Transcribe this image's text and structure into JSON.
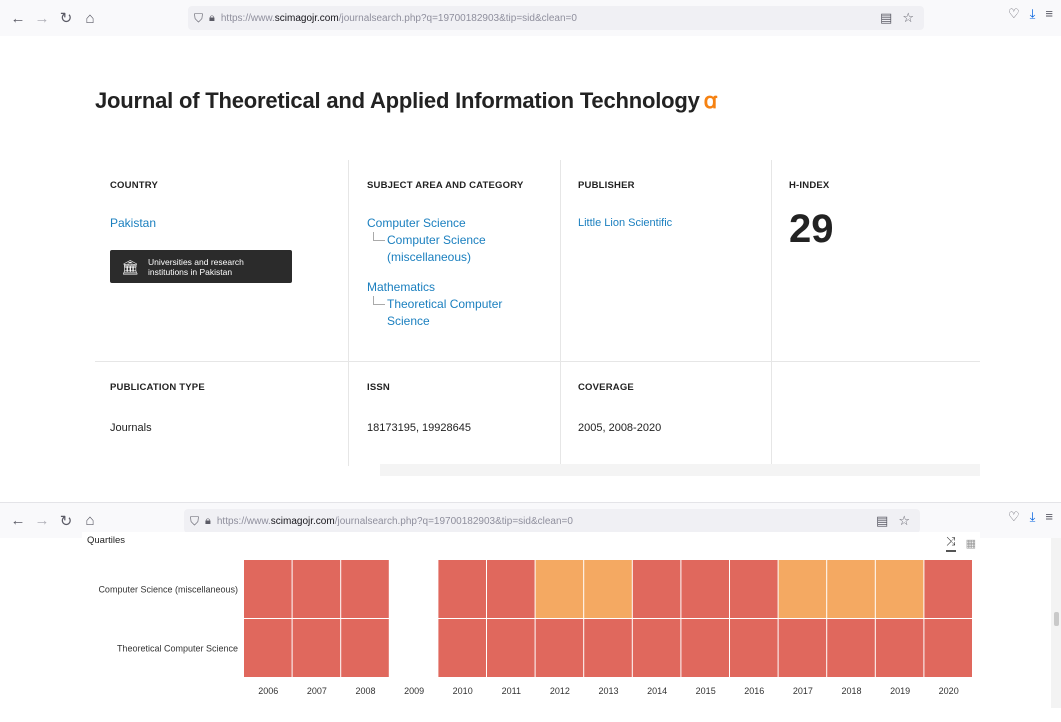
{
  "browser": {
    "url_prefix": "https://www.",
    "url_host": "scimagojr.com",
    "url_path": "/journalsearch.php?q=19700182903&tip=sid&clean=0"
  },
  "journal": {
    "title": "Journal of Theoretical and Applied Information Technology",
    "country_head": "COUNTRY",
    "country": "Pakistan",
    "uni_button": "Universities and research institutions in Pakistan",
    "subject_head": "SUBJECT AREA AND CATEGORY",
    "subjects": [
      {
        "area": "Computer Science",
        "category": "Computer Science (miscellaneous)"
      },
      {
        "area": "Mathematics",
        "category": "Theoretical Computer Science"
      }
    ],
    "publisher_head": "PUBLISHER",
    "publisher": "Little Lion Scientific",
    "hindex_head": "H-INDEX",
    "hindex": "29",
    "pubtype_head": "PUBLICATION TYPE",
    "pubtype": "Journals",
    "issn_head": "ISSN",
    "issn": "18173195, 19928645",
    "coverage_head": "COVERAGE",
    "coverage": "2005, 2008-2020"
  },
  "quartiles": {
    "title": "Quartiles"
  },
  "colors": {
    "q1": "#f4a962",
    "q2": "#e0685d",
    "link": "#1a7fbf",
    "open_access": "#f68212"
  },
  "chart_data": {
    "type": "heatmap",
    "title": "Quartiles",
    "x": [
      "2006",
      "2007",
      "2008",
      "2009",
      "2010",
      "2011",
      "2012",
      "2013",
      "2014",
      "2015",
      "2016",
      "2017",
      "2018",
      "2019",
      "2020"
    ],
    "rows": [
      {
        "name": "Computer Science (miscellaneous)",
        "values": [
          "Q2",
          "Q2",
          "Q2",
          null,
          "Q2",
          "Q2",
          "Q1",
          "Q1",
          "Q2",
          "Q2",
          "Q2",
          "Q1",
          "Q1",
          "Q1",
          "Q2"
        ]
      },
      {
        "name": "Theoretical Computer Science",
        "values": [
          "Q2",
          "Q2",
          "Q2",
          null,
          "Q2",
          "Q2",
          "Q2",
          "Q2",
          "Q2",
          "Q2",
          "Q2",
          "Q2",
          "Q2",
          "Q2",
          "Q2"
        ]
      }
    ]
  }
}
